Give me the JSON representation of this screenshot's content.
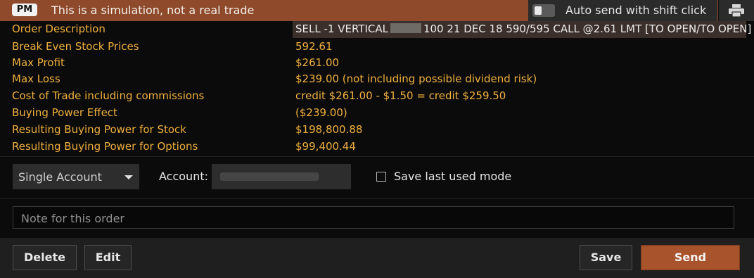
{
  "topbar": {
    "badge": "PM",
    "message": "This is a simulation, not a real trade",
    "autosend_label": "Auto send with shift click",
    "print_icon": "printer-icon"
  },
  "order": {
    "rows": [
      {
        "label": "Order Description",
        "value_pre": "SELL -1 VERTICAL",
        "value_post": "100 21 DEC 18 590/595 CALL @2.61 LMT [TO OPEN/TO OPEN]"
      },
      {
        "label": "Break Even Stock Prices",
        "value": "592.61"
      },
      {
        "label": "Max Profit",
        "value": "$261.00"
      },
      {
        "label": "Max Loss",
        "value": "$239.00 (not including possible dividend risk)"
      },
      {
        "label": "Cost of Trade including commissions",
        "value": "credit $261.00 - $1.50 = credit $259.50"
      },
      {
        "label": "Buying Power Effect",
        "value": "($239.00)"
      },
      {
        "label": "Resulting Buying Power for Stock",
        "value": "$198,800.88"
      },
      {
        "label": "Resulting Buying Power for Options",
        "value": "$99,400.44"
      }
    ]
  },
  "account": {
    "mode_selected": "Single Account",
    "account_label": "Account:",
    "save_mode_label": "Save last used mode"
  },
  "note": {
    "placeholder": "Note for this order"
  },
  "buttons": {
    "delete": "Delete",
    "edit": "Edit",
    "save": "Save",
    "send": "Send"
  },
  "colors": {
    "topbar": "#8e4a2b",
    "label_text": "#f0b03e",
    "send_button": "#a8532c"
  }
}
